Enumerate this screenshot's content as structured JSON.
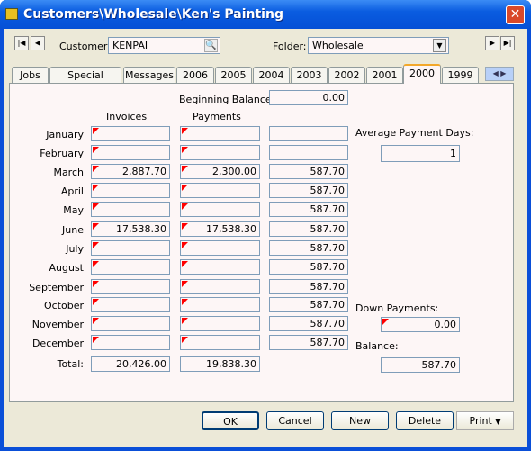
{
  "window": {
    "title": "Customers\\Wholesale\\Ken's Painting"
  },
  "header": {
    "customer_label": "Customer:",
    "customer_value": "KENPAI",
    "folder_label": "Folder:",
    "folder_value": "Wholesale"
  },
  "tabs": [
    "Jobs",
    "Special Pricing",
    "Messages",
    "2006",
    "2005",
    "2004",
    "2003",
    "2002",
    "2001",
    "2000",
    "1999"
  ],
  "active_tab": "2000",
  "main": {
    "beginning_balance_label": "Beginning Balance:",
    "beginning_balance": "0.00",
    "invoices_header": "Invoices",
    "payments_header": "Payments",
    "rows": [
      {
        "month": "January",
        "invoice": "",
        "payment": "",
        "balance": ""
      },
      {
        "month": "February",
        "invoice": "",
        "payment": "",
        "balance": ""
      },
      {
        "month": "March",
        "invoice": "2,887.70",
        "payment": "2,300.00",
        "balance": "587.70"
      },
      {
        "month": "April",
        "invoice": "",
        "payment": "",
        "balance": "587.70"
      },
      {
        "month": "May",
        "invoice": "",
        "payment": "",
        "balance": "587.70"
      },
      {
        "month": "June",
        "invoice": "17,538.30",
        "payment": "17,538.30",
        "balance": "587.70"
      },
      {
        "month": "July",
        "invoice": "",
        "payment": "",
        "balance": "587.70"
      },
      {
        "month": "August",
        "invoice": "",
        "payment": "",
        "balance": "587.70"
      },
      {
        "month": "September",
        "invoice": "",
        "payment": "",
        "balance": "587.70"
      },
      {
        "month": "October",
        "invoice": "",
        "payment": "",
        "balance": "587.70"
      },
      {
        "month": "November",
        "invoice": "",
        "payment": "",
        "balance": "587.70"
      },
      {
        "month": "December",
        "invoice": "",
        "payment": "",
        "balance": "587.70"
      }
    ],
    "total_label": "Total:",
    "total_invoices": "20,426.00",
    "total_payments": "19,838.30",
    "avg_payment_days_label": "Average Payment Days:",
    "avg_payment_days": "1",
    "down_payments_label": "Down Payments:",
    "down_payments": "0.00",
    "balance_label": "Balance:",
    "balance": "587.70"
  },
  "buttons": {
    "ok": "OK",
    "cancel": "Cancel",
    "new": "New",
    "delete": "Delete",
    "print": "Print"
  }
}
